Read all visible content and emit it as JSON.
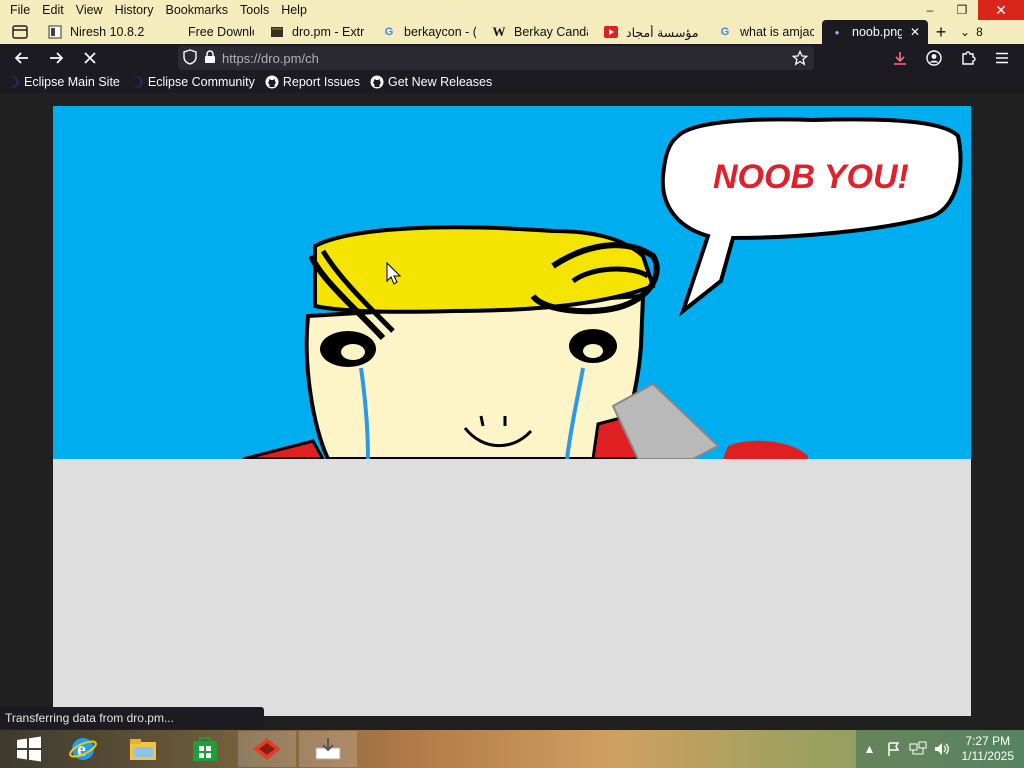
{
  "menu": [
    "File",
    "Edit",
    "View",
    "History",
    "Bookmarks",
    "Tools",
    "Help"
  ],
  "window_controls": {
    "minimize": "–",
    "restore": "❐",
    "close": "✕"
  },
  "tabs": [
    {
      "title": "Niresh 10.8.2",
      "icon": "document-icon"
    },
    {
      "title": "Free Downloa",
      "icon": ""
    },
    {
      "title": "dro.pm - Extr",
      "icon": "dropm-icon"
    },
    {
      "title": "berkaycon - (",
      "icon": "google-icon"
    },
    {
      "title": "Berkay Canda",
      "icon": "wikipedia-icon"
    },
    {
      "title": "مؤسسة أمجاد",
      "icon": "youtube-icon"
    },
    {
      "title": "what is amjac",
      "icon": "google-icon"
    },
    {
      "title": "noob.png",
      "icon": "dot-icon",
      "active": true
    }
  ],
  "tab_overflow_count": "8",
  "url": "https://dro.pm/ch",
  "bookmarks": [
    {
      "label": "Eclipse Main Site",
      "icon": "eclipse-icon"
    },
    {
      "label": "Eclipse Community",
      "icon": "eclipse-icon"
    },
    {
      "label": "Report Issues",
      "icon": "github-icon"
    },
    {
      "label": "Get New Releases",
      "icon": "github-icon"
    }
  ],
  "image": {
    "speech_text": "NOOB YOU!"
  },
  "status_text": "Transferring data from dro.pm...",
  "clock": {
    "time": "7:27 PM",
    "date": "1/11/2025"
  },
  "colors": {
    "title_bg": "#f4ecbd",
    "toolbar_bg": "#1c1b22",
    "sky": "#00aeef",
    "hair": "#f5e400",
    "speech_text": "#e0202a"
  }
}
